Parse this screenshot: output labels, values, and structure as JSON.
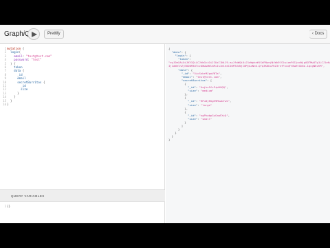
{
  "toolbar": {
    "title_prefix": "Graph",
    "title_italic": "i",
    "title_suffix": "QL",
    "prettify_label": "Prettify",
    "docs_label": "‹ Docs"
  },
  "query": {
    "lines": [
      [
        [
          "kw",
          "mutation"
        ],
        [
          "pun",
          " {"
        ]
      ],
      [
        [
          "pun",
          "  "
        ],
        [
          "fld",
          "login"
        ],
        [
          "pun",
          "("
        ]
      ],
      [
        [
          "pun",
          "    "
        ],
        [
          "att",
          "email"
        ],
        [
          "pun",
          ": "
        ],
        [
          "str",
          "\"test@test.com\""
        ]
      ],
      [
        [
          "pun",
          "    "
        ],
        [
          "att",
          "password"
        ],
        [
          "pun",
          ": "
        ],
        [
          "str",
          "\"test\""
        ]
      ],
      [
        [
          "pun",
          "  ) {"
        ]
      ],
      [
        [
          "pun",
          "    "
        ],
        [
          "fld",
          "token"
        ]
      ],
      [
        [
          "pun",
          "    "
        ],
        [
          "fld",
          "data"
        ],
        [
          "pun",
          " {"
        ]
      ],
      [
        [
          "pun",
          "      "
        ],
        [
          "fld",
          "_id"
        ]
      ],
      [
        [
          "pun",
          "      "
        ],
        [
          "fld",
          "email"
        ]
      ],
      [
        [
          "pun",
          "      "
        ],
        [
          "fld",
          "secretBurritos"
        ],
        [
          "pun",
          " {"
        ]
      ],
      [
        [
          "pun",
          "        "
        ],
        [
          "fld",
          "_id"
        ]
      ],
      [
        [
          "pun",
          "        "
        ],
        [
          "fld",
          "size"
        ]
      ],
      [
        [
          "pun",
          "      }"
        ]
      ],
      [
        [
          "pun",
          "    }"
        ]
      ],
      [
        [
          "pun",
          "  }"
        ]
      ],
      [
        [
          "pun",
          "}"
        ]
      ]
    ],
    "line_numbers": [
      "1",
      "2",
      "3",
      "4",
      "5",
      "6",
      "7",
      "8",
      "9",
      "10",
      "11",
      "12",
      "13",
      "14",
      "15",
      "16"
    ]
  },
  "query_variables": {
    "header": "QUERY VARIABLES",
    "lines": [
      [
        [
          "pun",
          "{}"
        ]
      ]
    ],
    "line_numbers": [
      "1"
    ]
  },
  "result": {
    "lines": [
      [
        [
          "pun",
          "{"
        ]
      ],
      [
        [
          "pun",
          "  "
        ],
        [
          "rk",
          "\"data\""
        ],
        [
          "pun",
          ": {"
        ]
      ],
      [
        [
          "pun",
          "    "
        ],
        [
          "rk",
          "\"login\""
        ],
        [
          "pun",
          ": {"
        ]
      ],
      [
        [
          "pun",
          "      "
        ],
        [
          "rk",
          "\"token\""
        ],
        [
          "pun",
          ":"
        ]
      ],
      [
        [
          "str",
          "\"eyJ0eXAiOiJKV1QiLCJhbGciOiJIUzI1NiJ9.eyJfaWQiOiJ1aWpkeWlSdFNwejNiWk9lSlwizmF0IjoxNjg0OTMwOTg1LCJleHAiOjE2ODQ5MTczOH0\""
        ]
      ],
      [
        [
          "str",
          "Ij1aWelhZjE0O0M3OTczOWUwOWlkMiIsImlhdCI6MTUxNjI0MjAxNn0.Qfq3K6Du7RZ3rnfFxxqFtBwHtGk6a-1qcgNKvhM\","
        ]
      ],
      [
        [
          "pun",
          "      "
        ],
        [
          "rk",
          "\"data\""
        ],
        [
          "pun",
          ": {"
        ]
      ],
      [
        [
          "pun",
          "        "
        ],
        [
          "rk",
          "\"_id\""
        ],
        [
          "pun",
          ": "
        ],
        [
          "str",
          "\"5icSnbrMJpoVNTa\""
        ],
        [
          "pun",
          ","
        ]
      ],
      [
        [
          "pun",
          "        "
        ],
        [
          "rk",
          "\"email\""
        ],
        [
          "pun",
          ": "
        ],
        [
          "str",
          "\"test@test.com\""
        ],
        [
          "pun",
          ","
        ]
      ],
      [
        [
          "pun",
          "        "
        ],
        [
          "rk",
          "\"secretBurritos\""
        ],
        [
          "pun",
          ": ["
        ]
      ],
      [
        [
          "pun",
          "          {"
        ]
      ],
      [
        [
          "pun",
          "            "
        ],
        [
          "rk",
          "\"_id\""
        ],
        [
          "pun",
          ": "
        ],
        [
          "str",
          "\"4ajkx5fcPipRXQQ\""
        ],
        [
          "pun",
          ","
        ]
      ],
      [
        [
          "pun",
          "            "
        ],
        [
          "rk",
          "\"size\""
        ],
        [
          "pun",
          ": "
        ],
        [
          "str",
          "\"medium\""
        ]
      ],
      [
        [
          "pun",
          "          },"
        ]
      ],
      [
        [
          "pun",
          "          {"
        ]
      ],
      [
        [
          "pun",
          "            "
        ],
        [
          "rk",
          "\"_id\""
        ],
        [
          "pun",
          ": "
        ],
        [
          "str",
          "\"9Pu8jN5gH9Mkwbfwk\""
        ],
        [
          "pun",
          ","
        ]
      ],
      [
        [
          "pun",
          "            "
        ],
        [
          "rk",
          "\"size\""
        ],
        [
          "pun",
          ": "
        ],
        [
          "str",
          "\"large\""
        ]
      ],
      [
        [
          "pun",
          "          },"
        ]
      ],
      [
        [
          "pun",
          "          {"
        ]
      ],
      [
        [
          "pun",
          "            "
        ],
        [
          "rk",
          "\"_id\""
        ],
        [
          "pun",
          ": "
        ],
        [
          "str",
          "\"ngPhwbpGuCmaFXcQ\""
        ],
        [
          "pun",
          ","
        ]
      ],
      [
        [
          "pun",
          "            "
        ],
        [
          "rk",
          "\"size\""
        ],
        [
          "pun",
          ": "
        ],
        [
          "str",
          "\"small\""
        ]
      ],
      [
        [
          "pun",
          "          }"
        ]
      ],
      [
        [
          "pun",
          "        ]"
        ]
      ],
      [
        [
          "pun",
          "      }"
        ]
      ],
      [
        [
          "pun",
          "    }"
        ]
      ],
      [
        [
          "pun",
          "  }"
        ]
      ],
      [
        [
          "pun",
          "}"
        ]
      ]
    ]
  }
}
